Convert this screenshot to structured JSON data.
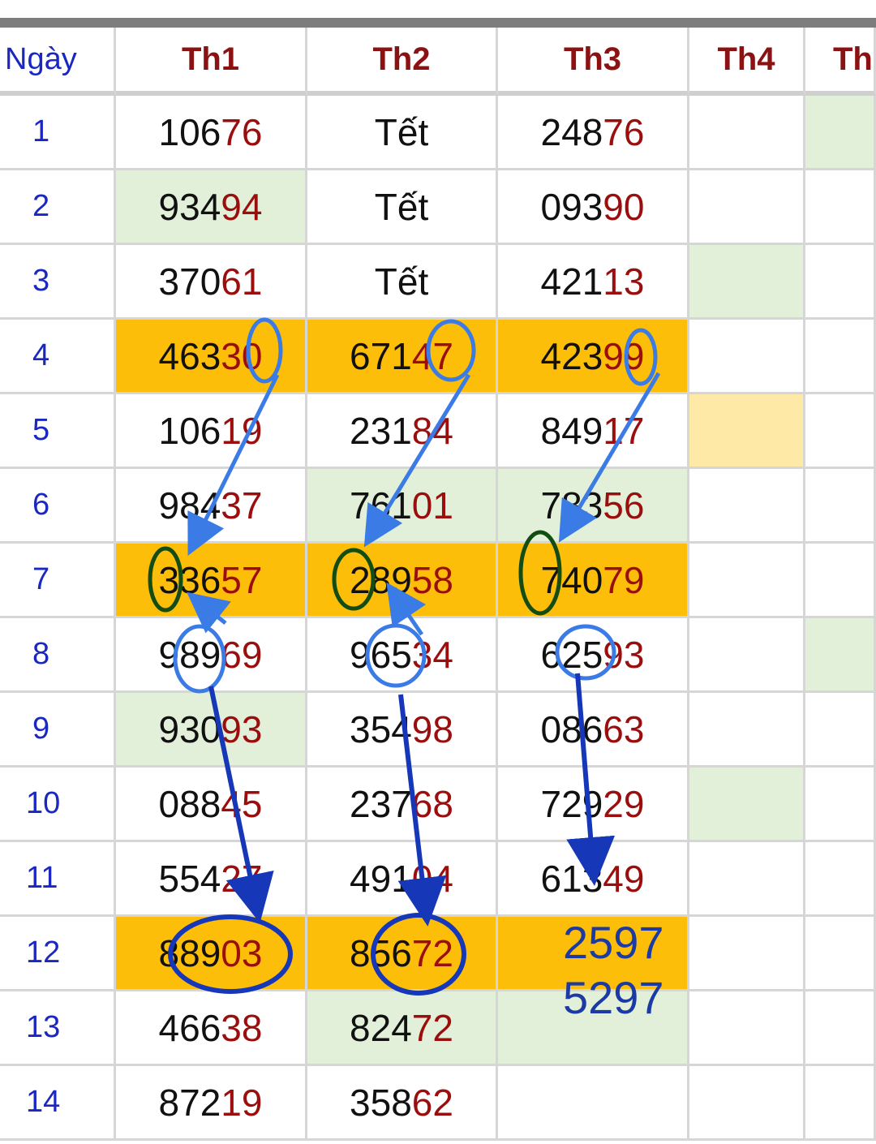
{
  "table": {
    "headers": [
      "Ngày",
      "Th1",
      "Th2",
      "Th3",
      "Th4",
      "Th"
    ],
    "rows": [
      {
        "day": "1",
        "cells": [
          {
            "head": "106",
            "tail": "76"
          },
          {
            "text": "Tết"
          },
          {
            "head": "248",
            "tail": "76"
          },
          {},
          {}
        ]
      },
      {
        "day": "2",
        "cells": [
          {
            "head": "934",
            "tail": "94"
          },
          {
            "text": "Tết"
          },
          {
            "head": "093",
            "tail": "90"
          },
          {},
          {}
        ]
      },
      {
        "day": "3",
        "cells": [
          {
            "head": "370",
            "tail": "61"
          },
          {
            "text": "Tết"
          },
          {
            "head": "421",
            "tail": "13"
          },
          {},
          {}
        ]
      },
      {
        "day": "4",
        "cells": [
          {
            "head": "463",
            "tail": "30"
          },
          {
            "head": "671",
            "tail": "47"
          },
          {
            "head": "423",
            "tail": "99"
          },
          {},
          {}
        ]
      },
      {
        "day": "5",
        "cells": [
          {
            "head": "106",
            "tail": "19"
          },
          {
            "head": "231",
            "tail": "84"
          },
          {
            "head": "849",
            "tail": "17"
          },
          {},
          {}
        ]
      },
      {
        "day": "6",
        "cells": [
          {
            "head": "984",
            "tail": "37"
          },
          {
            "head": "761",
            "tail": "01"
          },
          {
            "head": "783",
            "tail": "56"
          },
          {},
          {}
        ]
      },
      {
        "day": "7",
        "cells": [
          {
            "head": "336",
            "tail": "57"
          },
          {
            "head": "289",
            "tail": "58"
          },
          {
            "head": "740",
            "tail": "79"
          },
          {},
          {}
        ]
      },
      {
        "day": "8",
        "cells": [
          {
            "head": "989",
            "tail": "69"
          },
          {
            "head": "965",
            "tail": "34"
          },
          {
            "head": "625",
            "tail": "93"
          },
          {},
          {}
        ]
      },
      {
        "day": "9",
        "cells": [
          {
            "head": "930",
            "tail": "93"
          },
          {
            "head": "354",
            "tail": "98"
          },
          {
            "head": "086",
            "tail": "63"
          },
          {},
          {}
        ]
      },
      {
        "day": "10",
        "cells": [
          {
            "head": "088",
            "tail": "45"
          },
          {
            "head": "237",
            "tail": "68"
          },
          {
            "head": "729",
            "tail": "29"
          },
          {},
          {}
        ]
      },
      {
        "day": "11",
        "cells": [
          {
            "head": "554",
            "tail": "27"
          },
          {
            "head": "491",
            "tail": "04"
          },
          {
            "head": "613",
            "tail": "49"
          },
          {},
          {}
        ]
      },
      {
        "day": "12",
        "cells": [
          {
            "head": "889",
            "tail": "03"
          },
          {
            "head": "856",
            "tail": "72"
          },
          {},
          {},
          {}
        ]
      },
      {
        "day": "13",
        "cells": [
          {
            "head": "466",
            "tail": "38"
          },
          {
            "head": "824",
            "tail": "72"
          },
          {},
          {},
          {}
        ]
      },
      {
        "day": "14",
        "cells": [
          {
            "head": "872",
            "tail": "19"
          },
          {
            "head": "358",
            "tail": "62"
          },
          {},
          {},
          {}
        ]
      }
    ]
  },
  "annotations": {
    "prediction_line_1": "2597",
    "prediction_line_2": "5297"
  },
  "colors": {
    "highlight": "#fcbe09",
    "green_cell": "#e2f0d9",
    "yellow_cell": "#ffe9a6",
    "header_text": "#8b1212",
    "day_text": "#1a27c0",
    "tail_digits": "#9b0e0e"
  }
}
